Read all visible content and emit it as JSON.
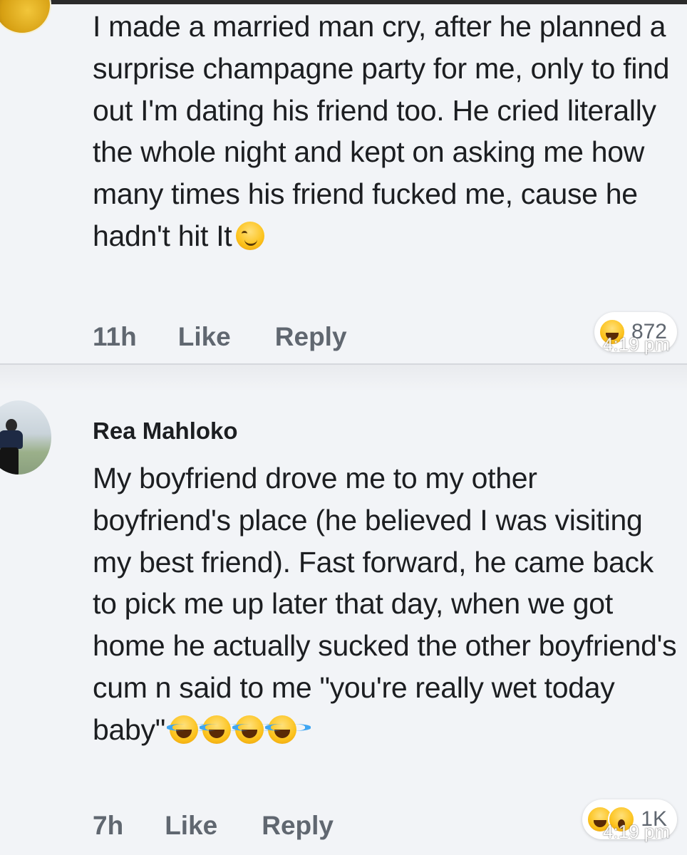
{
  "comments": [
    {
      "author": "",
      "text": "I made a married man cry, after he planned a surprise champagne party for me, only to find out I'm dating his friend too. He cried literally the whole night and kept on asking me how many times his friend fucked me, cause he hadn't hit It",
      "emoji": [
        "smirking-face"
      ],
      "time": "11h",
      "like_label": "Like",
      "reply_label": "Reply",
      "reactions": [
        "haha"
      ],
      "reaction_count": "872",
      "watermark": "4:19 pm"
    },
    {
      "author": "Rea Mahloko",
      "text": "My boyfriend drove me to my other boyfriend's place (he believed I was visiting my best friend). Fast forward, he came back to pick me up later that day, when we got home he actually sucked the other boyfriend's cum n said to me \"you're really wet today baby\"",
      "emoji": [
        "tears-of-joy",
        "tears-of-joy",
        "tears-of-joy",
        "tears-of-joy"
      ],
      "time": "7h",
      "like_label": "Like",
      "reply_label": "Reply",
      "reactions": [
        "haha",
        "wow"
      ],
      "reaction_count": "1K",
      "watermark": "4:19 pm"
    }
  ],
  "colors": {
    "background": "#f2f4f7",
    "text": "#1c1e21",
    "meta_text": "#606770"
  }
}
